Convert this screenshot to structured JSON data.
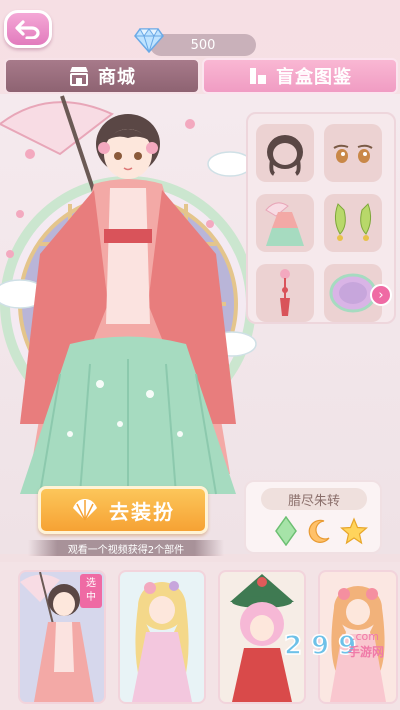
{
  "top_bar": {
    "gem_count": "500"
  },
  "tabs": {
    "shop_label": "商城",
    "gallery_label": "盲盒图鉴"
  },
  "parts": {
    "items": [
      "hair-piece",
      "eyes-piece",
      "parasol-dress-piece",
      "earrings-piece",
      "tassel-piece",
      "backdrop-piece"
    ]
  },
  "set_panel": {
    "name": "腊尽朱转"
  },
  "actions": {
    "dress_label": "去装扮",
    "hint_text": "观看一个视频获得2个部件"
  },
  "cards": {
    "selected_tag_line1": "选",
    "selected_tag_line2": "中"
  },
  "watermark": {
    "text_big": "2 9 9",
    "text_cn": "手游网",
    "text_com": ".com"
  },
  "colors": {
    "accent_pink": "#ef6aa4",
    "gold": "#f6a234",
    "tab_active": "#8e6372",
    "tab_inactive": "#f09cc3"
  }
}
